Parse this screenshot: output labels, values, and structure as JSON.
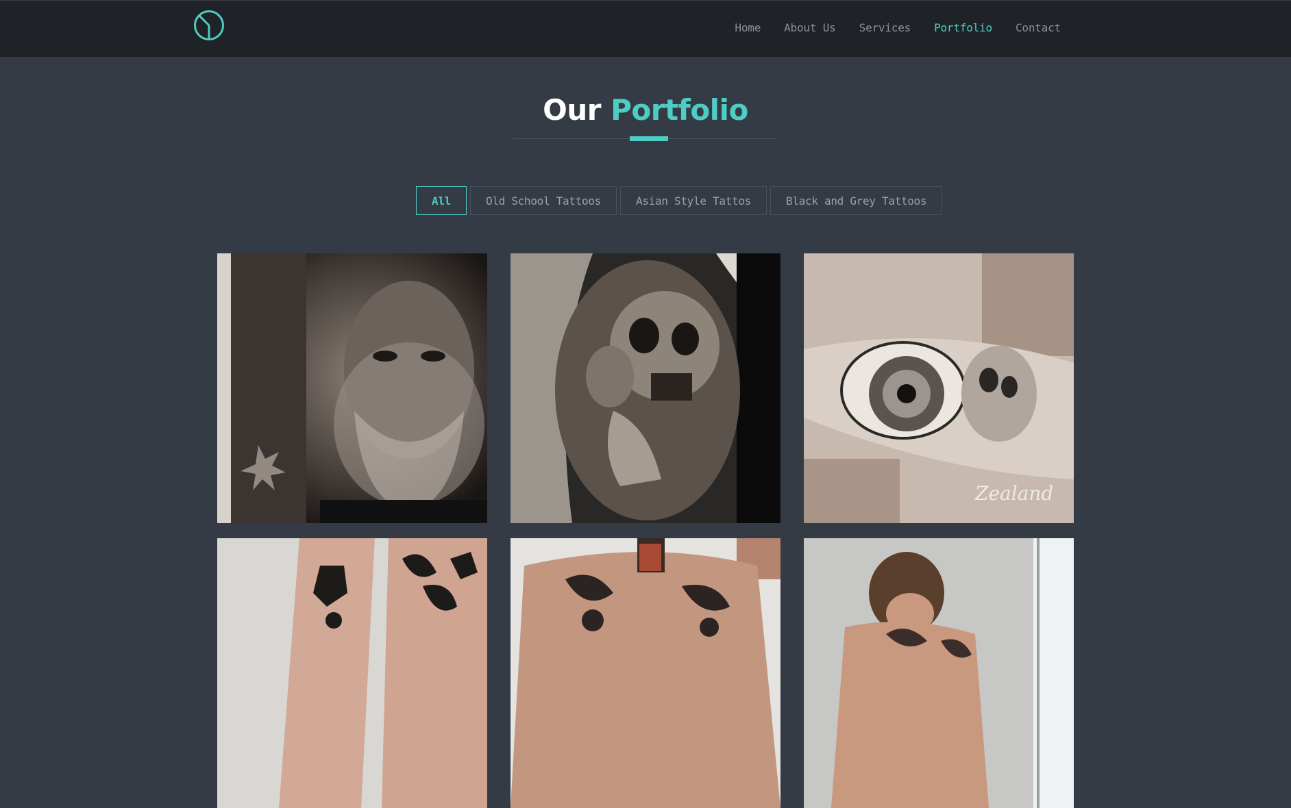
{
  "nav": {
    "logo_icon": "circle-slash-logo-icon",
    "links": [
      {
        "label": "Home",
        "active": false
      },
      {
        "label": "About Us",
        "active": false
      },
      {
        "label": "Services",
        "active": false
      },
      {
        "label": "Portfolio",
        "active": true
      },
      {
        "label": "Contact",
        "active": false
      }
    ]
  },
  "section": {
    "title_plain": "Our",
    "title_accent": "Portfolio"
  },
  "filters": [
    {
      "label": "All",
      "active": true
    },
    {
      "label": "Old School Tattoos",
      "active": false
    },
    {
      "label": "Asian Style Tattos",
      "active": false
    },
    {
      "label": "Black and Grey Tattoos",
      "active": false
    }
  ],
  "portfolio": {
    "items": [
      {
        "alt": "bearded-man-portrait-tattoo"
      },
      {
        "alt": "skull-and-hand-shoulder-tattoo"
      },
      {
        "alt": "clock-eye-skull-forearm-tattoo"
      },
      {
        "alt": "old-school-leg-tattoos"
      },
      {
        "alt": "chest-tattoo-selfie"
      },
      {
        "alt": "tattooed-man-photo"
      }
    ]
  },
  "colors": {
    "accent": "#4ecdc4",
    "nav_bg": "#1f2227",
    "page_bg": "#343b45"
  }
}
